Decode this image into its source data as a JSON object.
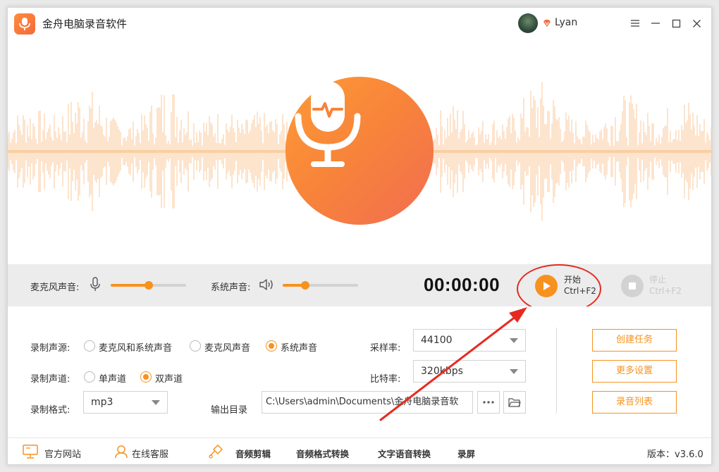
{
  "app": {
    "title": "金舟电脑录音软件",
    "user_name": "Lyan",
    "accent": "#f7921e"
  },
  "controls": {
    "mic_label": "麦克风声音:",
    "mic_level": 0.5,
    "system_label": "系统声音:",
    "system_level": 0.3,
    "timer": "00:00:00",
    "start_label": "开始",
    "start_shortcut": "Ctrl+F2",
    "stop_label": "停止",
    "stop_shortcut": "Ctrl+F2"
  },
  "settings": {
    "source_label": "录制声源:",
    "source_options": [
      "麦克风和系统声音",
      "麦克风声音",
      "系统声音"
    ],
    "source_selected": "系统声音",
    "channel_label": "录制声道:",
    "channel_options": [
      "单声道",
      "双声道"
    ],
    "channel_selected": "双声道",
    "format_label": "录制格式:",
    "format_value": "mp3",
    "output_label": "输出目录",
    "output_path": "C:\\Users\\admin\\Documents\\金舟电脑录音软",
    "sample_label": "采样率:",
    "sample_value": "44100",
    "bitrate_label": "比特率:",
    "bitrate_value": "320kbps"
  },
  "actions": {
    "create_task": "创建任务",
    "more_settings": "更多设置",
    "record_list": "录音列表"
  },
  "footer": {
    "website": "官方网站",
    "support": "在线客服",
    "audio_edit": "音频剪辑",
    "format_convert": "音频格式转换",
    "tts": "文字语音转换",
    "screen_record": "录屏",
    "version": "版本：v3.6.0"
  }
}
